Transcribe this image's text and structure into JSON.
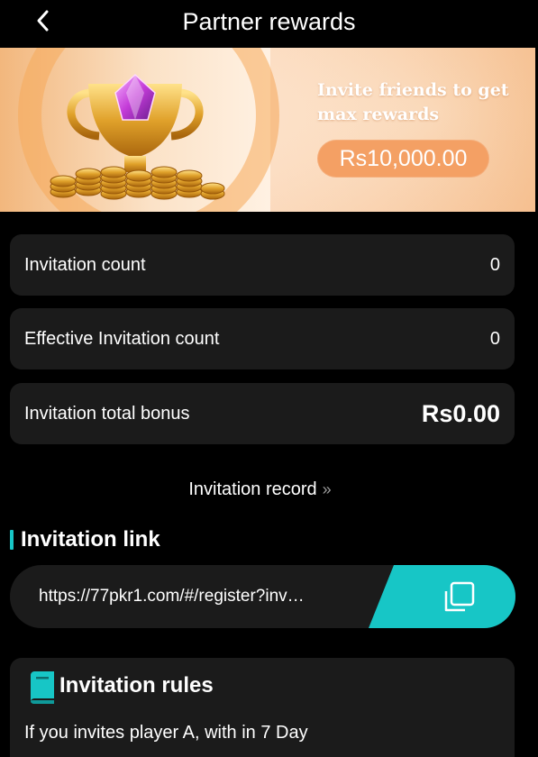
{
  "header": {
    "title": "Partner rewards"
  },
  "banner": {
    "headline": "Invite friends to get max rewards",
    "reward_amount": "Rs10,000.00"
  },
  "stats": [
    {
      "label": "Invitation count",
      "value": "0"
    },
    {
      "label": "Effective Invitation count",
      "value": "0"
    },
    {
      "label": "Invitation total bonus",
      "value": "Rs0.00"
    }
  ],
  "record": {
    "label": "Invitation record",
    "chevron": "»"
  },
  "invite_link": {
    "title": "Invitation link",
    "url": "https://77pkr1.com/#/register?inv…"
  },
  "rules": {
    "title": "Invitation rules",
    "text": "If you invites player A, with in 7 Day"
  },
  "colors": {
    "accent": "#17c6c6",
    "card_bg": "#1b1b1b",
    "reward_pill": "#f4a064",
    "background": "#000000"
  },
  "icons": {
    "back": "chevron-left-icon",
    "copy": "copy-icon",
    "rules": "book-icon",
    "record": "double-chevron-right-icon"
  }
}
